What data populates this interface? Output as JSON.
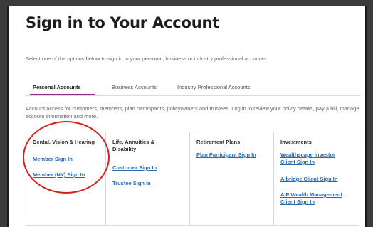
{
  "header": {
    "title": "Sign in to Your Account",
    "subtitle": "Select one of the options below to sign in to your personal, business or industry professional accounts."
  },
  "tabs": [
    {
      "label": "Personal Accounts",
      "active": true
    },
    {
      "label": "Business Accounts",
      "active": false
    },
    {
      "label": "Industry Professional Accounts",
      "active": false
    }
  ],
  "description": "Account access for customers, members, plan participants, policyowners and trustees. Log in to review your policy details, pay a bill, manage account information and more.",
  "cards": [
    {
      "title": "Dental, Vision & Hearing",
      "links": [
        "Member Sign In",
        "Member (NY) Sign In"
      ]
    },
    {
      "title": "Life, Annuities & Disability",
      "links": [
        "Customer Sign In",
        "Trustee Sign In"
      ]
    },
    {
      "title": "Retirement Plans",
      "links": [
        "Plan Participant Sign In"
      ]
    },
    {
      "title": "Investments",
      "links": [
        "Wealthscape Investor Client Sign In",
        "Albridge Client Sign In",
        "AIP Wealth Management Client Sign In"
      ]
    }
  ],
  "colors": {
    "tab_accent": "#8e2c8a",
    "link": "#2a6bb0",
    "highlight_circle": "#d42020"
  }
}
